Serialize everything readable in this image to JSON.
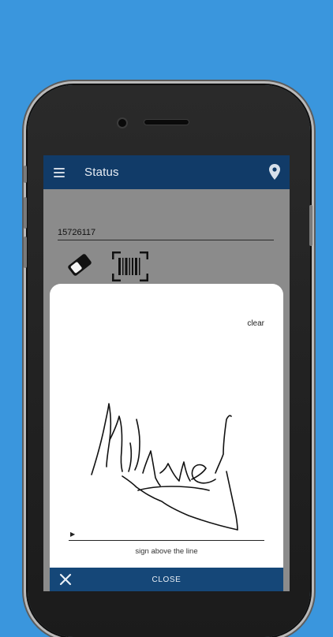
{
  "appbar": {
    "title": "Status",
    "menu_icon": "menu-icon",
    "location_icon": "location-pin-icon"
  },
  "form": {
    "id_value": "15726117",
    "eraser_icon": "eraser-icon",
    "barcode_icon": "barcode-scan-icon"
  },
  "signature_dialog": {
    "clear_label": "clear",
    "hint_text": "sign above the line",
    "close_label": "CLOSE",
    "close_icon": "close-icon"
  },
  "colors": {
    "background": "#3a96dd",
    "appbar": "#113b68",
    "close_bar": "#154778"
  }
}
